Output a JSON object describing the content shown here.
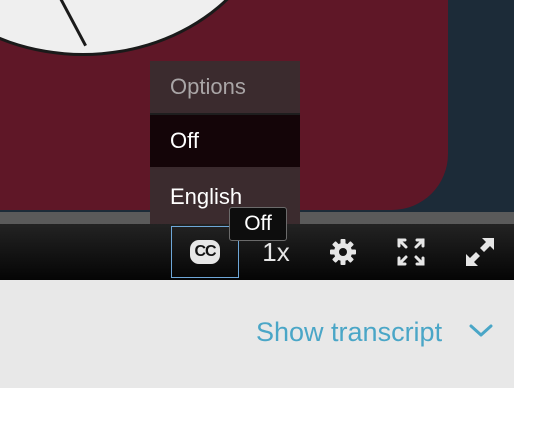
{
  "player": {
    "captions_menu": {
      "title": "Options",
      "items": [
        {
          "label": "Off",
          "selected": true
        },
        {
          "label": "English",
          "selected": false
        }
      ]
    },
    "tooltip": "Off",
    "controls": {
      "cc_icon_text": "CC",
      "speed": "1x",
      "icons": [
        "closed-captions-icon",
        "gear-icon",
        "fullscreen-arrows-icon",
        "expand-icon"
      ]
    }
  },
  "transcript": {
    "label": "Show transcript",
    "icon": "chevron-down-icon"
  },
  "colors": {
    "accent": "#4aa6c7",
    "focus_outline": "#6ea7d8",
    "video_maroon": "#5f1727",
    "video_navy": "#1c2b38"
  }
}
